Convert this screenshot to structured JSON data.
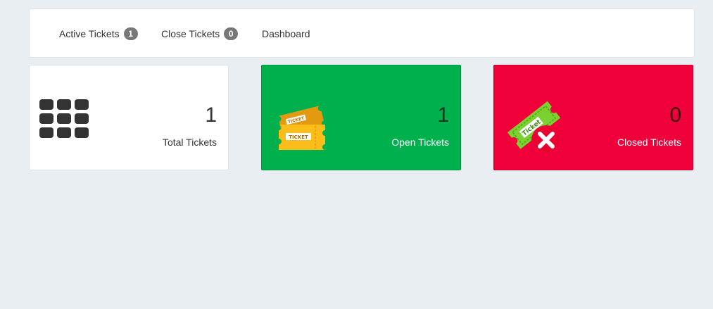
{
  "nav": {
    "items": [
      {
        "label": "Active Tickets",
        "badge": "1"
      },
      {
        "label": "Close Tickets",
        "badge": "0"
      },
      {
        "label": "Dashboard"
      }
    ]
  },
  "cards": [
    {
      "count": "1",
      "label": "Total Tickets",
      "icon": "grid-icon"
    },
    {
      "count": "1",
      "label": "Open Tickets",
      "icon": "ticket-icon",
      "ticket_text": "TICKET"
    },
    {
      "count": "0",
      "label": "Closed Tickets",
      "icon": "closed-ticket-icon",
      "ticket_text": "Ticket"
    }
  ],
  "colors": {
    "open_card": "#00b04d",
    "closed_card": "#f0003a",
    "badge": "#777777"
  }
}
